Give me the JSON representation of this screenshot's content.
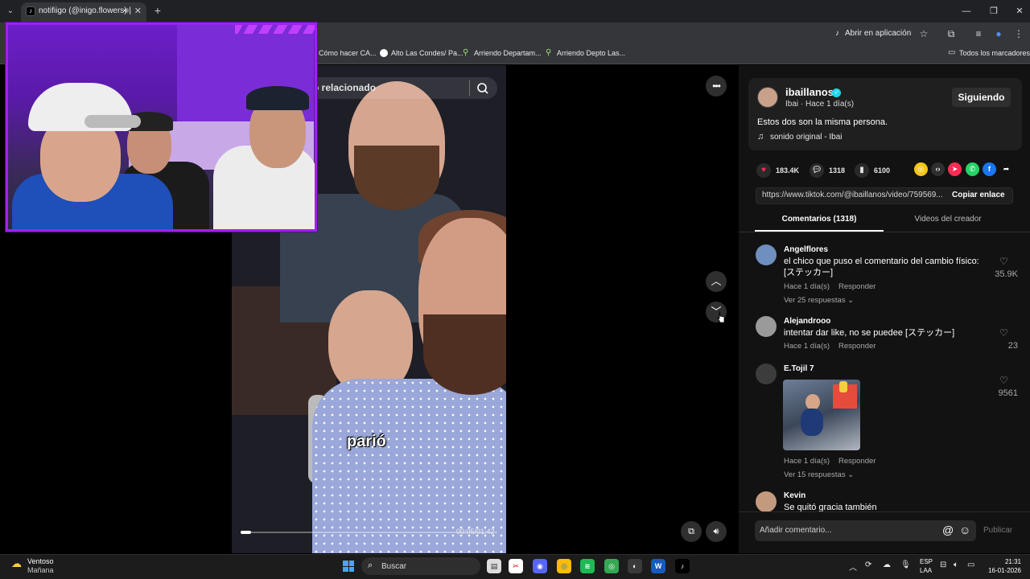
{
  "browser": {
    "tab_title": "notifiigo (@inigo.flowers) |",
    "new_tab_symbol": "+",
    "open_in_app": "Abrir en aplicación",
    "bookmarks": [
      {
        "label": "Cómo hacer CA..."
      },
      {
        "label": "Alto Las Condes/ Pa..."
      },
      {
        "label": "Arriendo Departam..."
      },
      {
        "label": "Arriendo Depto Las..."
      }
    ],
    "all_bookmarks": "Todos los marcadores"
  },
  "player": {
    "search_text": "o relacionado",
    "subtitle": "parió",
    "progress_fraction": 0.04,
    "timecode": "00:05/01:42"
  },
  "panel": {
    "author": "ibaillanos",
    "author_sub": "Ibai · Hace 1 día(s)",
    "follow_label": "Siguiendo",
    "caption": "Estos dos son la misma persona.",
    "sound": "sonido original - Ibai",
    "stats": {
      "likes": "183.4K",
      "comments": "1318",
      "saves": "6100"
    },
    "url": "https://www.tiktok.com/@ibaillanos/video/759569...",
    "copy_link": "Copiar enlace",
    "tab_comments": "Comentarios (1318)",
    "tab_videos": "Videos del creador",
    "comments": [
      {
        "name": "Angelflores",
        "text": "el chico que puso el comentario del cambio físico: [ステッカー]",
        "meta": "Hace 1 día(s)",
        "reply": "Responder",
        "more": "Ver 25 respuestas ⌄",
        "likes": "35.9K"
      },
      {
        "name": "Alejandrooo",
        "text": "intentar dar like, no se puedee [ステッカー]",
        "meta": "Hace 1 día(s)",
        "reply": "Responder",
        "likes": "23"
      },
      {
        "name": "E.Tojil 7",
        "meta": "Hace 1 día(s)",
        "reply": "Responder",
        "more": "Ver 15 respuestas ⌄",
        "likes": "9561"
      },
      {
        "name": "Kevin",
        "text": "Se quitó gracia también"
      }
    ],
    "comment_placeholder": "Añadir comentario...",
    "publish": "Publicar"
  },
  "taskbar": {
    "weather_1": "Ventoso",
    "weather_2": "Mañana",
    "search": "Buscar",
    "lang_1": "ESP",
    "lang_2": "LAA",
    "time": "21:31",
    "date": "16-01-2026"
  },
  "colors": {
    "like_red": "#fe2c55",
    "verified": "#20d5ec",
    "cam_border": "#a020f0"
  }
}
